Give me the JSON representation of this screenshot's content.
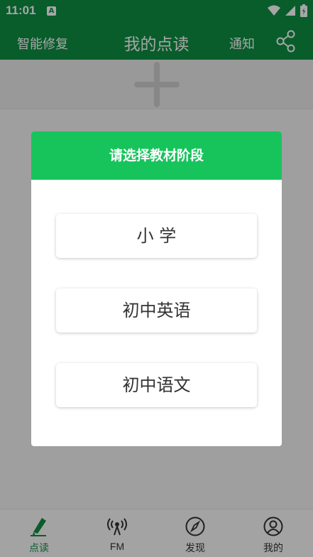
{
  "status_bar": {
    "time": "11:01",
    "notification_icon_letter": "A",
    "icons": [
      "wifi-icon",
      "signal-icon",
      "battery-icon"
    ]
  },
  "app_bar": {
    "left_action": "智能修复",
    "title": "我的点读",
    "notify_action": "通知",
    "share_icon": "share-icon",
    "color": "#0d8f43"
  },
  "content": {
    "add_icon": "plus-icon"
  },
  "dialog": {
    "title": "请选择教材阶段",
    "header_color": "#17c45c",
    "options": [
      {
        "label": "小 学"
      },
      {
        "label": "初中英语"
      },
      {
        "label": "初中语文"
      }
    ]
  },
  "bottom_nav": {
    "active_color": "#0d8f43",
    "items": [
      {
        "label": "点读",
        "icon": "pen-icon",
        "active": true
      },
      {
        "label": "FM",
        "icon": "broadcast-icon",
        "active": false
      },
      {
        "label": "发现",
        "icon": "compass-icon",
        "active": false
      },
      {
        "label": "我的",
        "icon": "profile-icon",
        "active": false
      }
    ]
  }
}
